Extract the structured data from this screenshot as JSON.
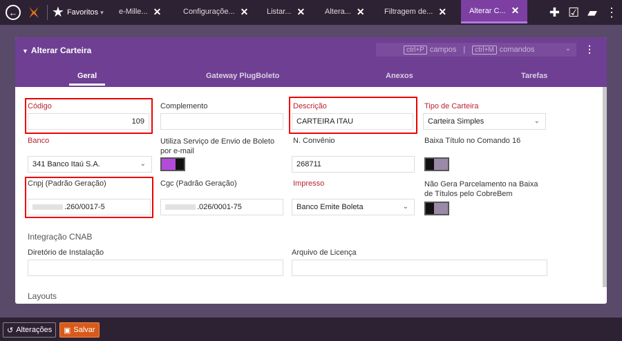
{
  "topbar": {
    "favorites_label": "Favoritos",
    "tabs": [
      {
        "label": "e-Mille...",
        "close": "✕"
      },
      {
        "label": "Configuraçõe...",
        "close": "✕"
      },
      {
        "label": "Listar...",
        "close": "✕"
      },
      {
        "label": "Altera...",
        "close": "✕"
      },
      {
        "label": "Filtragem de...",
        "close": "✕"
      },
      {
        "label": "Alterar C...",
        "close": "✕"
      }
    ]
  },
  "panel": {
    "title": "Alterar Carteira",
    "cmd_key1": "ctrl+P",
    "cmd_word1": "campos",
    "cmd_key2": "ctrl+M",
    "cmd_word2": "comandos",
    "tabs": [
      "Geral",
      "Gateway PlugBoleto",
      "Anexos",
      "Tarefas"
    ]
  },
  "form": {
    "codigo": {
      "label": "Código",
      "value": "109"
    },
    "complemento": {
      "label": "Complemento",
      "value": ""
    },
    "descricao": {
      "label": "Descrição",
      "value": "CARTEIRA ITAU"
    },
    "tipo_carteira": {
      "label": "Tipo de Carteira",
      "value": "Carteira Simples"
    },
    "banco": {
      "label": "Banco",
      "value": "341 Banco Itaú S.A."
    },
    "servico_envio": {
      "label_line1": "Utiliza Serviço de Envio de Boleto",
      "label_line2": "por e-mail",
      "on": true
    },
    "n_convenio": {
      "label": "N. Convênio",
      "value": "268711"
    },
    "baixa_titulo": {
      "label": "Baixa Título no Comando 16",
      "on": false
    },
    "cnpj": {
      "label": "Cnpj (Padrão Geração)",
      "value": ".260/0017-5"
    },
    "cgc": {
      "label": "Cgc (Padrão Geração)",
      "value": ".026/0001-75"
    },
    "impresso": {
      "label": "Impresso",
      "value": "Banco Emite Boleta"
    },
    "nao_gera": {
      "label_line1": "Não Gera Parcelamento na Baixa",
      "label_line2": "de Títulos pelo CobreBem",
      "on": false
    },
    "integracao_section": "Integração CNAB",
    "diretorio": {
      "label": "Diretório de Instalação",
      "value": ""
    },
    "arquivo_licenca": {
      "label": "Arquivo de Licença",
      "value": ""
    },
    "layouts_section": "Layouts"
  },
  "bottombar": {
    "alteracoes_label": "Alterações",
    "salvar_label": "Salvar"
  },
  "colors": {
    "accent": "#6e3f92",
    "highlight": "#ee0000",
    "save": "#d85a1a"
  }
}
